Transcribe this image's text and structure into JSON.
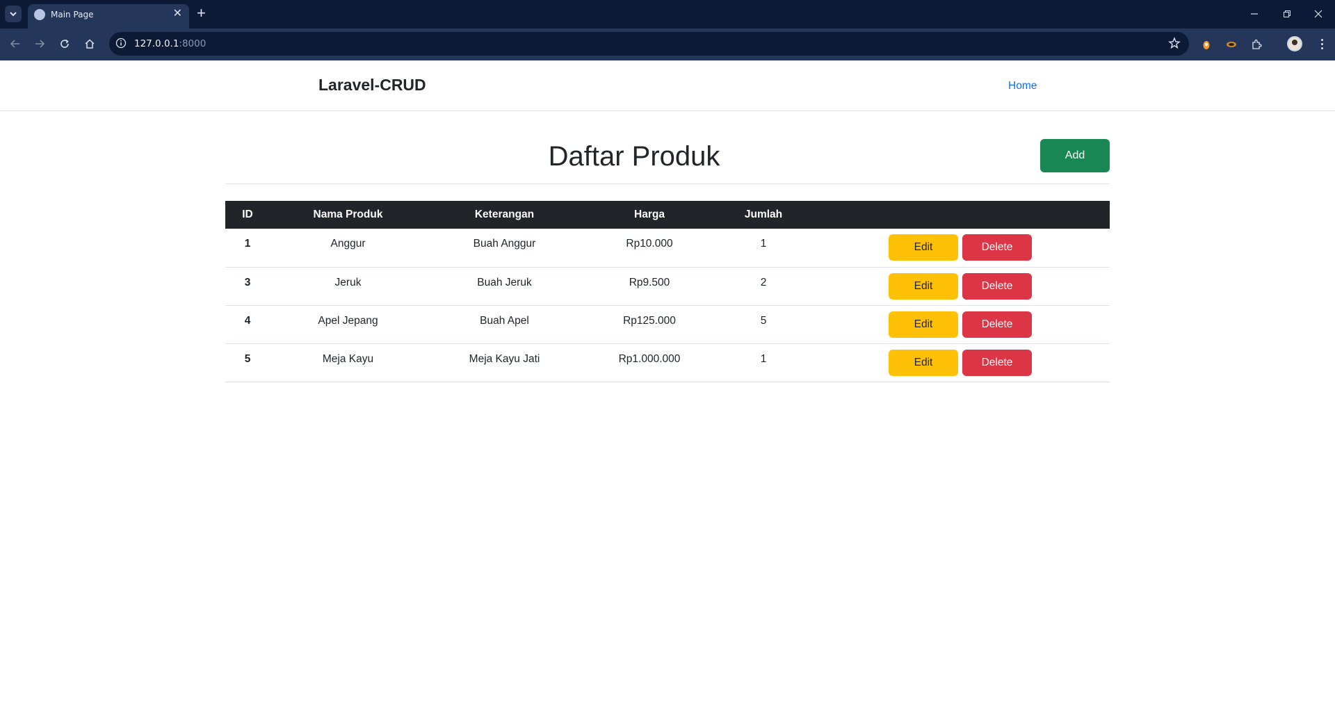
{
  "browser": {
    "tab_title": "Main Page",
    "url_host": "127.0.0.1",
    "url_port": ":8000"
  },
  "navbar": {
    "brand": "Laravel-CRUD",
    "home_link": "Home"
  },
  "main": {
    "title": "Daftar Produk",
    "add_label": "Add",
    "columns": [
      "ID",
      "Nama Produk",
      "Keterangan",
      "Harga",
      "Jumlah",
      ""
    ],
    "rows": [
      {
        "id": "1",
        "nama": "Anggur",
        "keterangan": "Buah Anggur",
        "harga": "Rp10.000",
        "jumlah": "1"
      },
      {
        "id": "3",
        "nama": "Jeruk",
        "keterangan": "Buah Jeruk",
        "harga": "Rp9.500",
        "jumlah": "2"
      },
      {
        "id": "4",
        "nama": "Apel Jepang",
        "keterangan": "Buah Apel",
        "harga": "Rp125.000",
        "jumlah": "5"
      },
      {
        "id": "5",
        "nama": "Meja Kayu",
        "keterangan": "Meja Kayu Jati",
        "harga": "Rp1.000.000",
        "jumlah": "1"
      }
    ],
    "edit_label": "Edit",
    "delete_label": "Delete"
  },
  "colors": {
    "add": "#198754",
    "edit": "#ffc107",
    "delete": "#dc3545",
    "table_header": "#212529",
    "link": "#0d6efd"
  },
  "icons": [
    "chevron-down-icon",
    "close-icon",
    "plus-icon",
    "back-arrow-icon",
    "forward-arrow-icon",
    "reload-icon",
    "home-icon",
    "info-icon",
    "star-icon",
    "extension-icon",
    "minimize-icon",
    "restore-icon",
    "close-window-icon"
  ]
}
